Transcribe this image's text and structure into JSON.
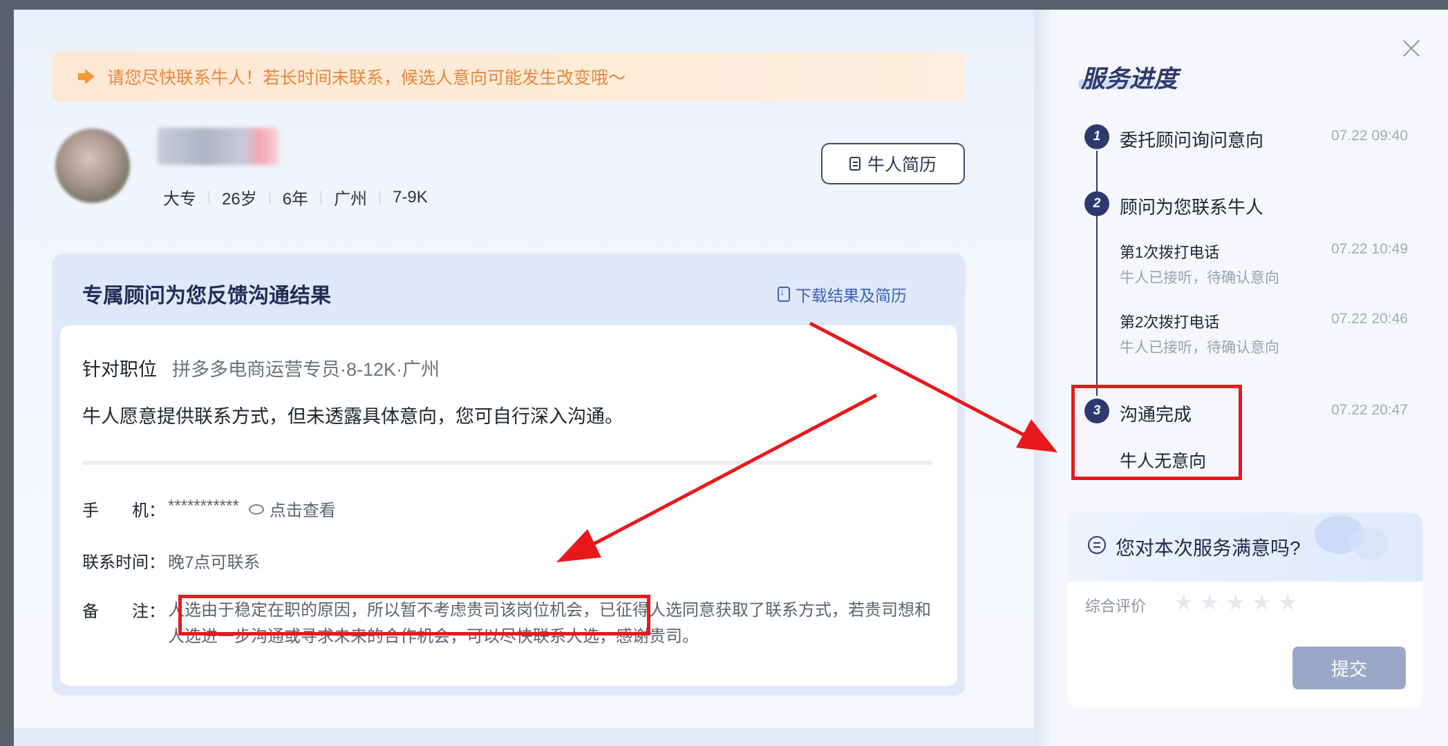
{
  "notice": {
    "text": "请您尽快联系牛人！若长时间未联系，候选人意向可能发生改变哦～"
  },
  "candidate": {
    "education": "大专",
    "age": "26岁",
    "experience": "6年",
    "city": "广州",
    "salary": "7-9K",
    "resume_button": "牛人简历"
  },
  "feedback": {
    "title": "专属顾问为您反馈沟通结果",
    "download_link": "下载结果及简历",
    "position_label": "针对职位",
    "position_value": "拼多多电商运营专员·8-12K·广州",
    "summary": "牛人愿意提供联系方式，但未透露具体意向，您可自行深入沟通。",
    "phone_label": "手　　机：",
    "phone_value": "***********",
    "phone_view": "点击查看",
    "contact_time_label": "联系时间：",
    "contact_time_value": "晚7点可联系",
    "remark_label": "备　　注：",
    "remark_highlight": "人选由于稳定在职的原因，所以暂不考虑贵司该岗位机会",
    "remark_rest": "，已征得人选同意获取了联系方式，若贵司想和人选进一步沟通或寻求未来的合作机会，可以尽快联系人选，感谢贵司。"
  },
  "progress": {
    "title": "服务进度",
    "steps": [
      {
        "num": "1",
        "title": "委托顾问询问意向",
        "time": "07.22 09:40"
      },
      {
        "num": "2",
        "title": "顾问为您联系牛人",
        "time": "",
        "sub": [
          {
            "title": "第1次拨打电话",
            "desc": "牛人已接听，待确认意向",
            "time": "07.22 10:49"
          },
          {
            "title": "第2次拨打电话",
            "desc": "牛人已接听，待确认意向",
            "time": "07.22 20:46"
          }
        ]
      },
      {
        "num": "3",
        "title": "沟通完成",
        "time": "07.22 20:47",
        "result": "牛人无意向"
      }
    ]
  },
  "satisfaction": {
    "question": "您对本次服务满意吗?",
    "rating_label": "综合评价",
    "rating": 0,
    "max_rating": 5,
    "submit": "提交"
  }
}
